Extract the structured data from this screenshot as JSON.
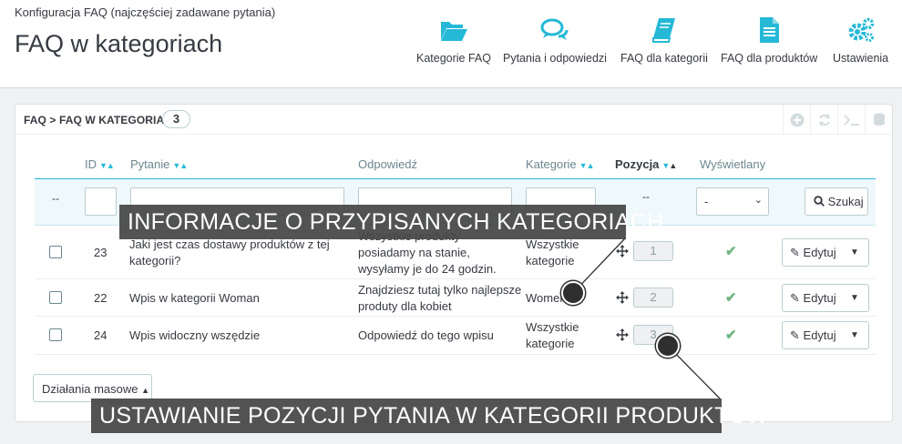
{
  "header": {
    "breadcrumb": "Konfiguracja FAQ (najczęściej zadawane pytania)",
    "title": "FAQ w kategoriach"
  },
  "toolbar": [
    {
      "label": "Kategorie FAQ",
      "icon": "folder-open-icon"
    },
    {
      "label": "Pytania i odpowiedzi",
      "icon": "comments-icon"
    },
    {
      "label": "FAQ dla kategorii",
      "icon": "book-icon"
    },
    {
      "label": "FAQ dla produktów",
      "icon": "document-icon"
    },
    {
      "label": "Ustawienia",
      "icon": "gears-icon"
    }
  ],
  "panel": {
    "title": "FAQ > FAQ W KATEGORIACH",
    "count": "3"
  },
  "columns": {
    "id": "ID",
    "question": "Pytanie",
    "answer": "Odpowiedź",
    "category": "Kategorie",
    "position": "Pozycja",
    "displayed": "Wyświetlany"
  },
  "filters": {
    "select_all_dash": "--",
    "position_dash": "--",
    "displayed_value": "-",
    "search_label": "Szukaj"
  },
  "rows": [
    {
      "id": "23",
      "question": "Jaki jest czas dostawy produktów z tej kategorii?",
      "answer": "Wszystkie produkty posiadamy na stanie, wysyłamy je do 24 godzin.",
      "category": "Wszystkie kategorie",
      "position": "1",
      "edit": "Edytuj"
    },
    {
      "id": "22",
      "question": "Wpis w kategorii Woman",
      "answer": "Znajdziesz tutaj tylko najlepsze produty dla kobiet",
      "category": "Women",
      "position": "2",
      "edit": "Edytuj"
    },
    {
      "id": "24",
      "question": "Wpis widoczny wszędzie",
      "answer": "Odpowiedź do tego wpisu",
      "category": "Wszystkie kategorie",
      "position": "3",
      "edit": "Edytuj"
    }
  ],
  "bulk_actions": "Działania masowe",
  "callouts": {
    "categories": "INFORMACJE O PRZYPISANYCH KATEGORIACH",
    "position": "USTAWIANIE POZYCJI PYTANIA W KATEGORII PRODUKTÓW"
  },
  "colors": {
    "accent": "#25b9d7",
    "success": "#70b580",
    "text": "#363a41"
  }
}
